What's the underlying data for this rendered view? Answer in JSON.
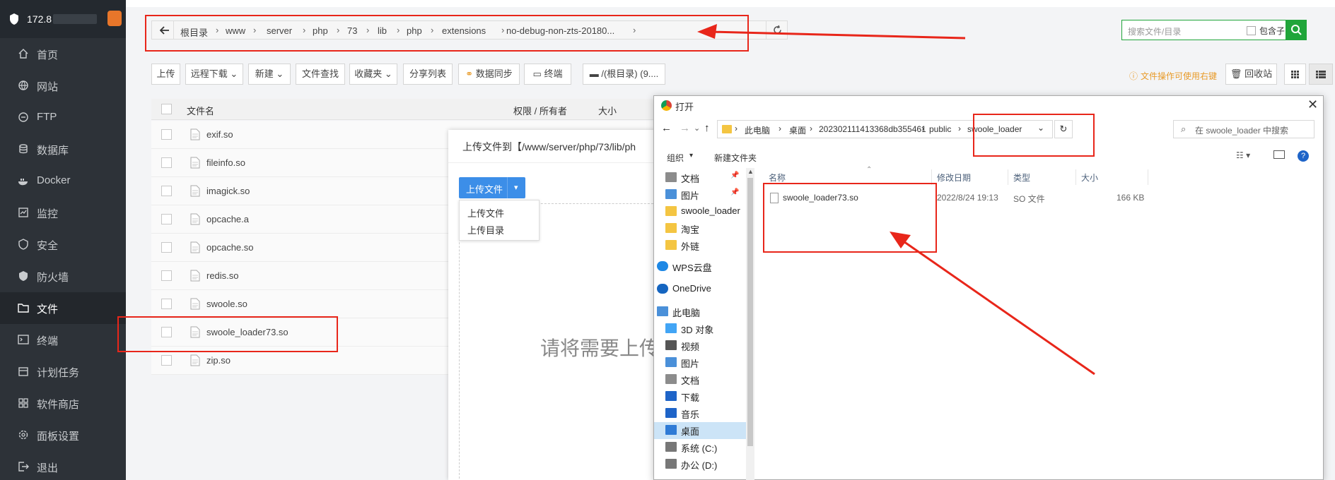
{
  "sidebar": {
    "server_ip": "172.8",
    "items": [
      {
        "label": "首页",
        "icon": "home-icon"
      },
      {
        "label": "网站",
        "icon": "globe-icon"
      },
      {
        "label": "FTP",
        "icon": "ftp-icon"
      },
      {
        "label": "数据库",
        "icon": "database-icon"
      },
      {
        "label": "Docker",
        "icon": "docker-icon"
      },
      {
        "label": "监控",
        "icon": "monitor-icon"
      },
      {
        "label": "安全",
        "icon": "shield-icon"
      },
      {
        "label": "防火墙",
        "icon": "firewall-icon"
      },
      {
        "label": "文件",
        "icon": "folder-icon"
      },
      {
        "label": "终端",
        "icon": "terminal-icon"
      },
      {
        "label": "计划任务",
        "icon": "calendar-icon"
      },
      {
        "label": "软件商店",
        "icon": "grid-icon"
      },
      {
        "label": "面板设置",
        "icon": "gear-icon"
      },
      {
        "label": "退出",
        "icon": "logout-icon"
      }
    ]
  },
  "breadcrumb": {
    "segments": [
      "根目录",
      "www",
      "server",
      "php",
      "73",
      "lib",
      "php",
      "extensions",
      "no-debug-non-zts-20180..."
    ]
  },
  "search": {
    "placeholder": "搜索文件/目录",
    "subdir_label": "包含子目录"
  },
  "toolbar": {
    "upload": "上传",
    "remote_download": "远程下载",
    "new": "新建",
    "find": "文件查找",
    "favorites": "收藏夹",
    "share_list": "分享列表",
    "sync": "数据同步",
    "terminal": "终端",
    "disk": "/(根目录) (9....",
    "tip": "文件操作可使用右键",
    "recycle": "回收站"
  },
  "table": {
    "headers": {
      "name": "文件名",
      "perm": "权限 / 所有者",
      "size": "大小"
    },
    "files": [
      "exif.so",
      "fileinfo.so",
      "imagick.so",
      "opcache.a",
      "opcache.so",
      "redis.so",
      "swoole.so",
      "swoole_loader73.so",
      "zip.so"
    ]
  },
  "upload_dialog": {
    "title": "上传文件到【/www/server/php/73/lib/ph",
    "upload_btn": "上传文件",
    "menu": [
      "上传文件",
      "上传目录"
    ],
    "drop_hint": "请将需要上传"
  },
  "file_dialog": {
    "title": "打开",
    "path": [
      "此电脑",
      "桌面",
      "202302111413368db355461",
      "public",
      "swoole_loader"
    ],
    "search_placeholder": "在 swoole_loader 中搜索",
    "organize": "组织",
    "new_folder": "新建文件夹",
    "columns": {
      "name": "名称",
      "modified": "修改日期",
      "type": "类型",
      "size": "大小"
    },
    "tree": [
      {
        "label": "文档",
        "icon": "document-icon",
        "pinned": true
      },
      {
        "label": "图片",
        "icon": "picture-icon",
        "pinned": true
      },
      {
        "label": "swoole_loader",
        "icon": "folder-icon"
      },
      {
        "label": "淘宝",
        "icon": "folder-icon"
      },
      {
        "label": "外链",
        "icon": "folder-icon"
      },
      {
        "label": "WPS云盘",
        "icon": "cloud-icon"
      },
      {
        "label": "OneDrive",
        "icon": "onedrive-icon"
      },
      {
        "label": "此电脑",
        "icon": "computer-icon"
      },
      {
        "label": "3D 对象",
        "icon": "cube-icon"
      },
      {
        "label": "视频",
        "icon": "video-icon"
      },
      {
        "label": "图片",
        "icon": "picture-icon"
      },
      {
        "label": "文档",
        "icon": "document-icon"
      },
      {
        "label": "下载",
        "icon": "download-icon"
      },
      {
        "label": "音乐",
        "icon": "music-icon"
      },
      {
        "label": "桌面",
        "icon": "desktop-icon",
        "selected": true
      },
      {
        "label": "系统 (C:)",
        "icon": "drive-icon"
      },
      {
        "label": "办公 (D:)",
        "icon": "drive-icon"
      }
    ],
    "files": [
      {
        "name": "swoole_loader73.so",
        "modified": "2022/8/24 19:13",
        "type": "SO 文件",
        "size": "166 KB"
      }
    ]
  },
  "colors": {
    "accent_green": "#20a53a",
    "annotation_red": "#e8261a",
    "upload_blue": "#3c8ee8",
    "sidebar": "#2d3238"
  }
}
